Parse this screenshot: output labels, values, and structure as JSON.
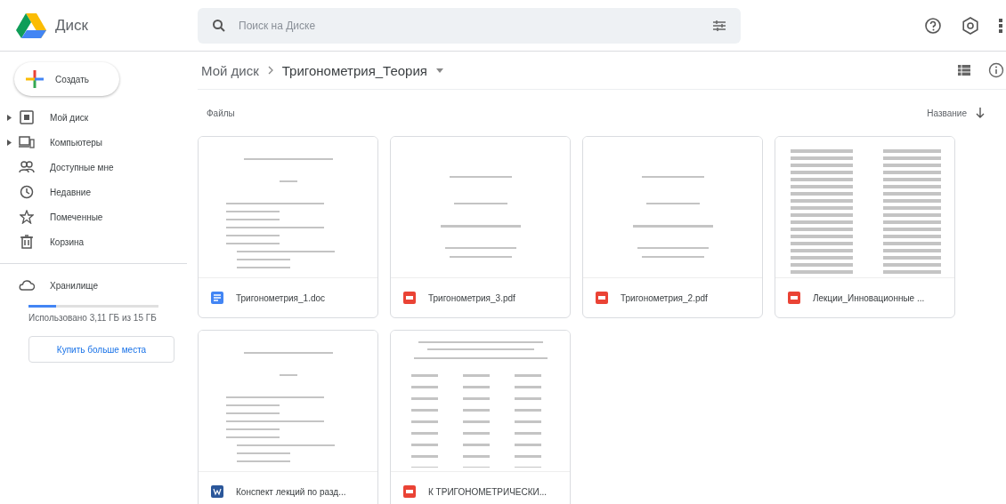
{
  "header": {
    "app_name": "Диск",
    "search": {
      "placeholder": "Поиск на Диске"
    }
  },
  "new_button": {
    "label": "Создать"
  },
  "sidebar": {
    "items": [
      {
        "label": "Мой диск",
        "expandable": true
      },
      {
        "label": "Компьютеры",
        "expandable": true
      },
      {
        "label": "Доступные мне",
        "expandable": false
      },
      {
        "label": "Недавние",
        "expandable": false
      },
      {
        "label": "Помеченные",
        "expandable": false
      },
      {
        "label": "Корзина",
        "expandable": false
      }
    ],
    "storage": {
      "label": "Хранилище",
      "level": 0.21,
      "usage": "Использовано 3,11 ГБ из 15 ГБ",
      "buy_button": "Купить больше места"
    }
  },
  "breadcrumb": [
    "Мой диск",
    "Тригонометрия_Теория"
  ],
  "section_title": "Файлы",
  "sort": {
    "label": "Название"
  },
  "files": [
    {
      "name": "Тригонометрия_1.doc",
      "kind": "doc"
    },
    {
      "name": "Тригонометрия_3.pdf",
      "kind": "pdf"
    },
    {
      "name": "Тригонометрия_2.pdf",
      "kind": "pdf"
    },
    {
      "name": "Лекции_Инновационные ...",
      "kind": "pdf"
    },
    {
      "name": "Конспект лекций по разд...",
      "kind": "word"
    },
    {
      "name": "К ТРИГОНОМЕТРИЧЕСКИ...",
      "kind": "pdf"
    }
  ]
}
